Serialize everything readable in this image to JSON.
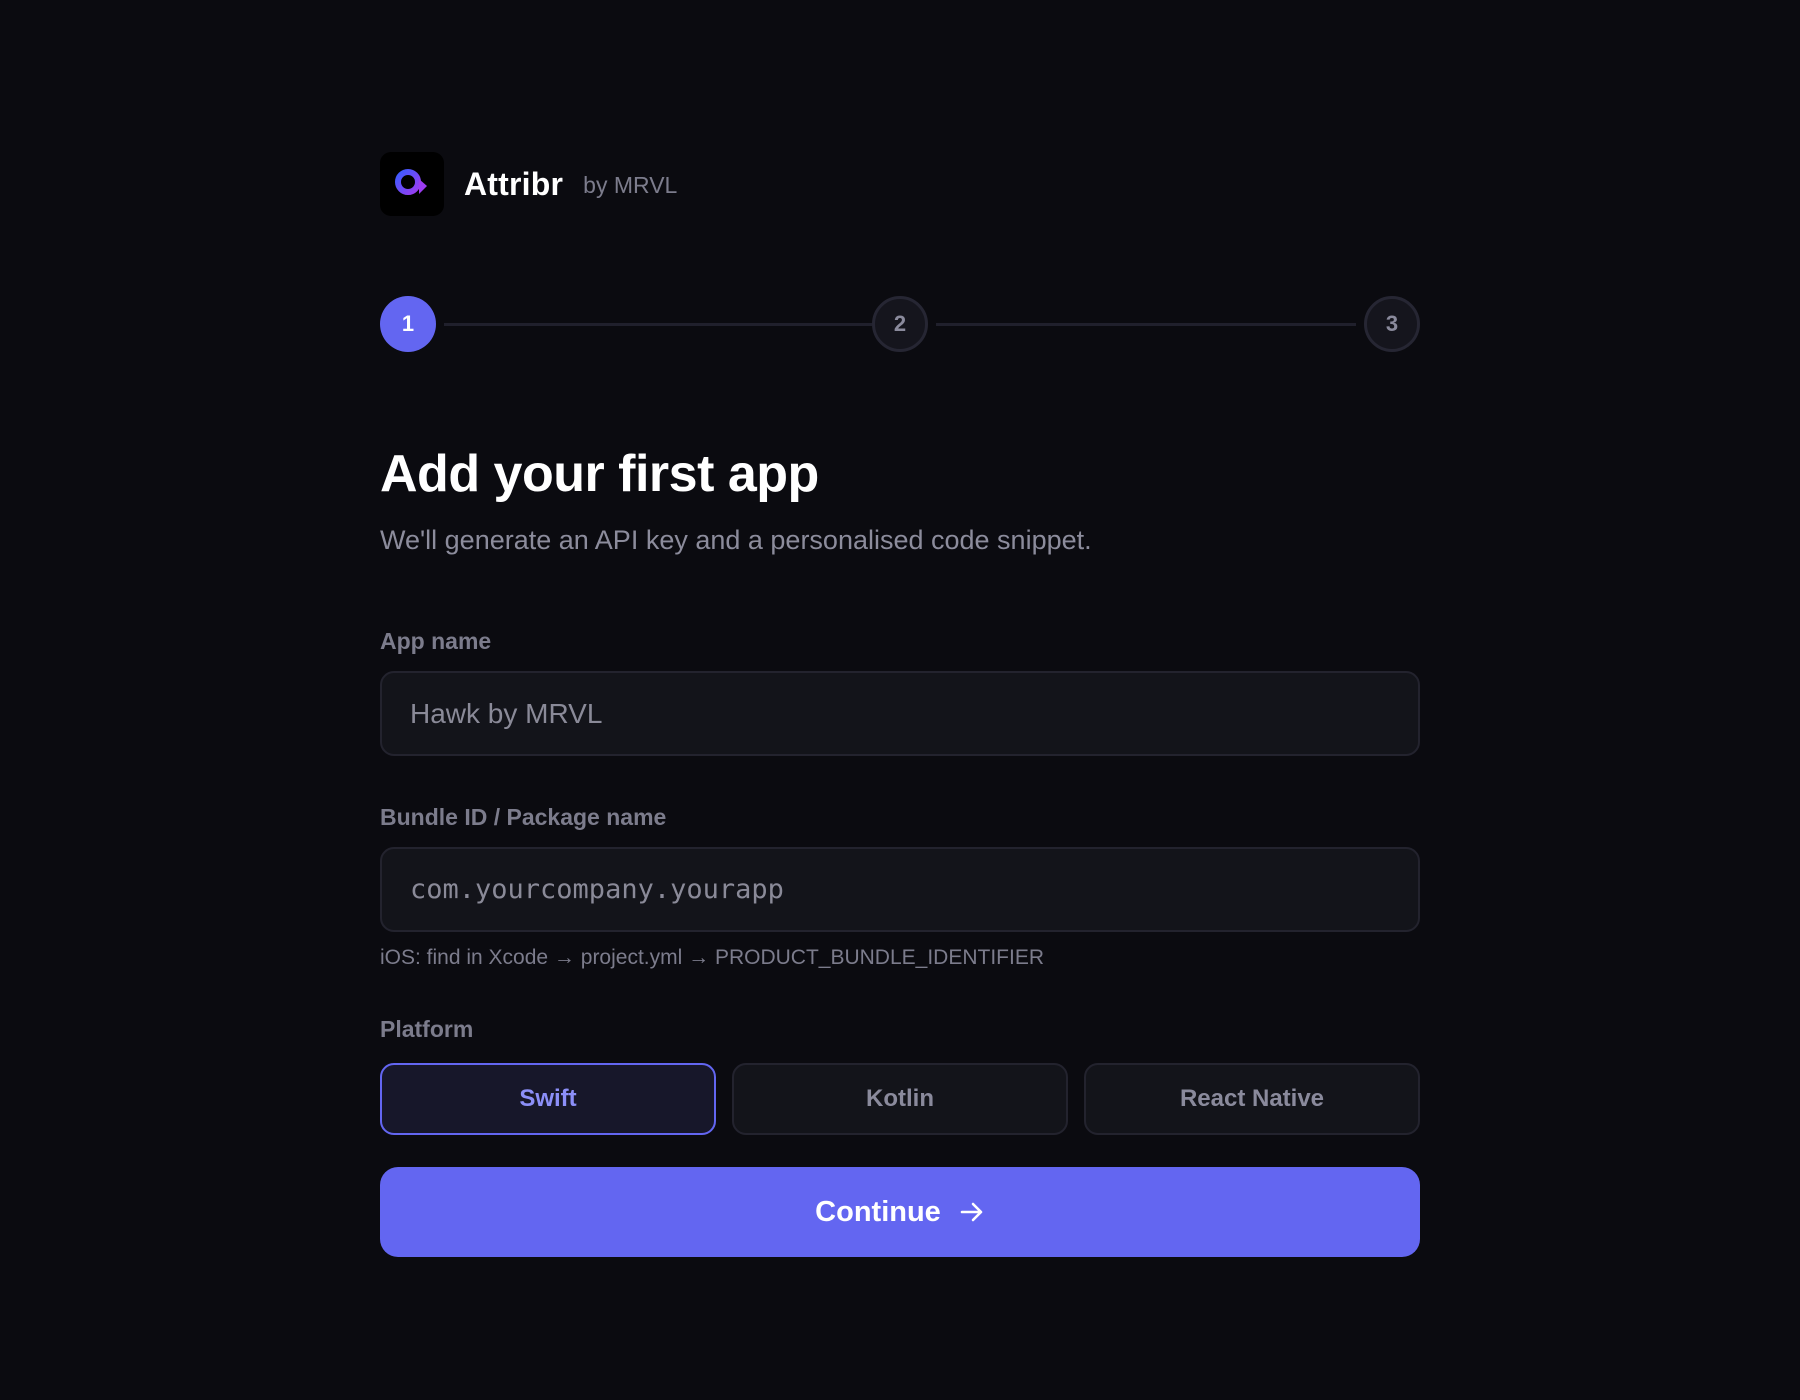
{
  "brand": {
    "name": "Attribr",
    "byline": "by MRVL",
    "logo_icon": "attribr-logo-icon"
  },
  "stepper": {
    "steps": [
      "1",
      "2",
      "3"
    ],
    "current": 1,
    "active_color": "#6366f1"
  },
  "header": {
    "title": "Add your first app",
    "subtitle": "We'll generate an API key and a personalised code snippet."
  },
  "form": {
    "app_name": {
      "label": "App name",
      "placeholder": "Hawk by MRVL",
      "value": ""
    },
    "bundle_id": {
      "label": "Bundle ID / Package name",
      "placeholder": "com.yourcompany.yourapp",
      "value": "",
      "hint": "iOS: find in Xcode → project.yml → PRODUCT_BUNDLE_IDENTIFIER"
    },
    "platform": {
      "label": "Platform",
      "options": [
        "Swift",
        "Kotlin",
        "React Native"
      ],
      "selected": "Swift"
    }
  },
  "actions": {
    "continue_label": "Continue",
    "continue_icon": "arrow-right-icon"
  }
}
